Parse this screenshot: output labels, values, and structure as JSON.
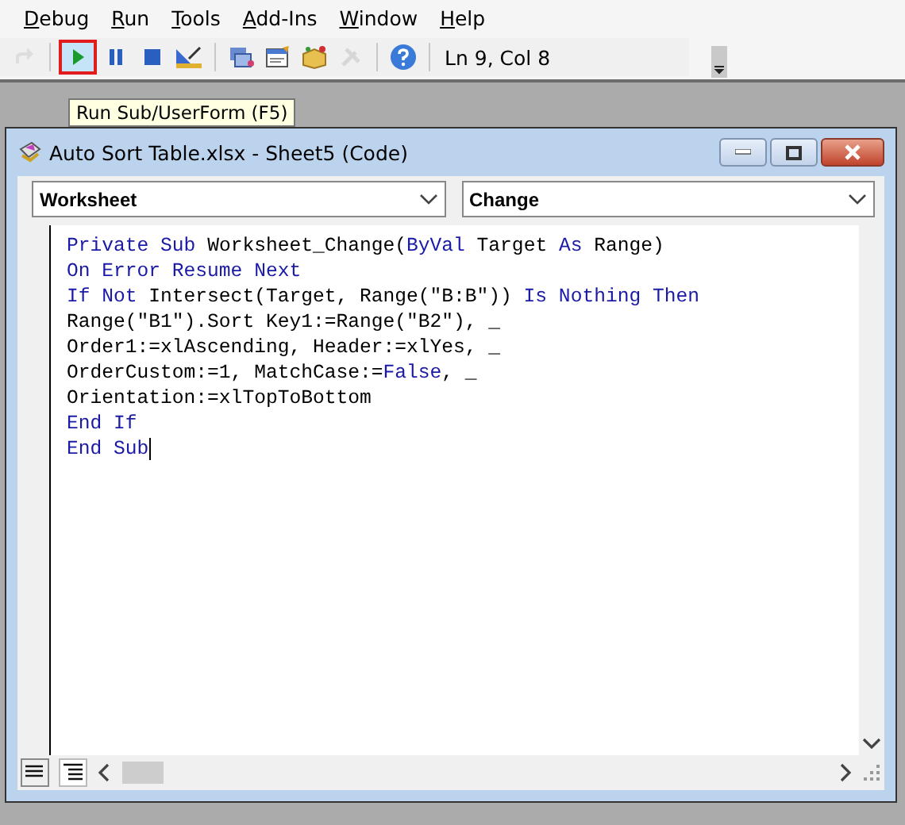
{
  "menu": [
    {
      "label": "Debug"
    },
    {
      "label": "Run"
    },
    {
      "label": "Tools"
    },
    {
      "label": "Add-Ins"
    },
    {
      "label": "Window"
    },
    {
      "label": "Help"
    }
  ],
  "toolbar": {
    "items": [
      {
        "kind": "redo",
        "disabled": true
      },
      {
        "kind": "sep"
      },
      {
        "kind": "run",
        "highlighted": true
      },
      {
        "kind": "pause"
      },
      {
        "kind": "stop"
      },
      {
        "kind": "design"
      },
      {
        "kind": "sep"
      },
      {
        "kind": "explorer"
      },
      {
        "kind": "properties"
      },
      {
        "kind": "browser"
      },
      {
        "kind": "toolbox",
        "disabled": true
      },
      {
        "kind": "sep"
      },
      {
        "kind": "help"
      }
    ],
    "status": "Ln 9, Col 8"
  },
  "tooltip": "Run Sub/UserForm (F5)",
  "window": {
    "title": "Auto Sort Table.xlsx - Sheet5 (Code)",
    "object_dropdown": "Worksheet",
    "procedure_dropdown": "Change",
    "code": [
      [
        {
          "t": "Private Sub ",
          "kind": "keyword"
        },
        {
          "t": "Worksheet_Change(",
          "kind": "plain"
        },
        {
          "t": "ByVal ",
          "kind": "keyword"
        },
        {
          "t": "Target ",
          "kind": "plain"
        },
        {
          "t": "As ",
          "kind": "keyword"
        },
        {
          "t": "Range)",
          "kind": "plain"
        }
      ],
      [
        {
          "t": "On Error Resume Next",
          "kind": "keyword"
        }
      ],
      [
        {
          "t": "If Not ",
          "kind": "keyword"
        },
        {
          "t": "Intersect(Target, Range(\"B:B\")) ",
          "kind": "plain"
        },
        {
          "t": "Is Nothing Then",
          "kind": "keyword"
        }
      ],
      [
        {
          "t": "Range(\"B1\").Sort Key1:=Range(\"B2\"), _",
          "kind": "plain"
        }
      ],
      [
        {
          "t": "Order1:=xlAscending, Header:=xlYes, _",
          "kind": "plain"
        }
      ],
      [
        {
          "t": "OrderCustom:=1, MatchCase:=",
          "kind": "plain"
        },
        {
          "t": "False",
          "kind": "keyword"
        },
        {
          "t": ", _",
          "kind": "plain"
        }
      ],
      [
        {
          "t": "Orientation:=xlTopToBottom",
          "kind": "plain"
        }
      ],
      [
        {
          "t": "End If",
          "kind": "keyword"
        }
      ],
      [
        {
          "t": "End Sub",
          "kind": "keyword"
        }
      ]
    ],
    "view_buttons": [
      {
        "kind": "procedure",
        "selected": false
      },
      {
        "kind": "module",
        "selected": true
      }
    ]
  }
}
